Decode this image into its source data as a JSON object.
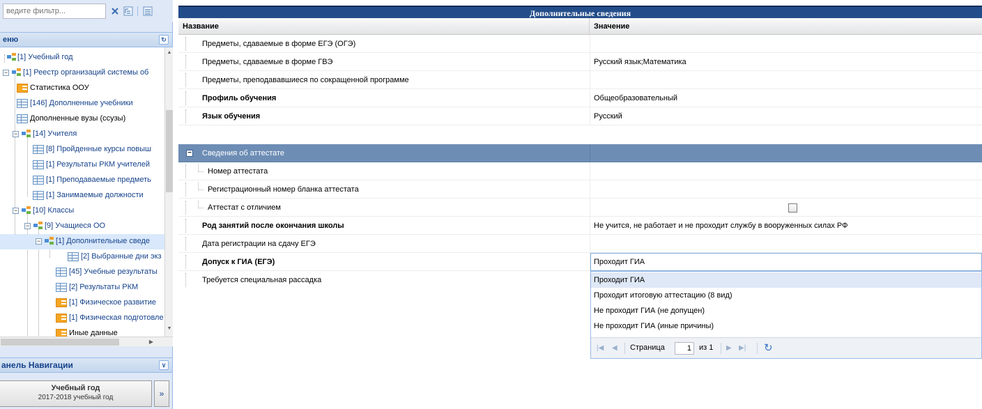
{
  "filter": {
    "placeholder": "ведите фильтр..."
  },
  "menu": {
    "title": "еню"
  },
  "tree": [
    {
      "label": "[1] Учебный год"
    },
    {
      "label": "[1] Реестр организаций системы об"
    },
    {
      "label": "Статистика ООУ"
    },
    {
      "label": "[146] Дополненные учебники"
    },
    {
      "label": "Дополненные вузы (ссузы)"
    },
    {
      "label": "[14] Учителя"
    },
    {
      "label": "[8] Пройденные курсы повыш"
    },
    {
      "label": "[1] Результаты РКМ учителей"
    },
    {
      "label": "[1] Преподаваемые предметь"
    },
    {
      "label": "[1] Занимаемые должности"
    },
    {
      "label": "[10] Классы"
    },
    {
      "label": "[9] Учащиеся ОО"
    },
    {
      "label": "[1] Дополнительные сведе"
    },
    {
      "label": "[2] Выбранные дни экз"
    },
    {
      "label": "[45] Учебные результаты"
    },
    {
      "label": "[2] Результаты РКМ"
    },
    {
      "label": "[1] Физическое развитие"
    },
    {
      "label": "[1] Физическая подготовле"
    },
    {
      "label": "Иные данные"
    }
  ],
  "nav": {
    "title": "анель Навигации",
    "card_title": "Учебный год",
    "card_value": "2017-2018 учебный год",
    "more": "»"
  },
  "grid": {
    "caption": "Дополнительные сведения",
    "col_name": "Название",
    "col_value": "Значение",
    "rows": [
      {
        "name": "Предметы, сдаваемые в форме ЕГЭ (ОГЭ)",
        "value": ""
      },
      {
        "name": "Предметы, сдаваемые в форме ГВЭ",
        "value": "Русский язык;Математика"
      },
      {
        "name": "Предметы, преподававшиеся по сокращенной программе",
        "value": ""
      },
      {
        "name": "Профиль обучения",
        "value": "Общеобразовательный"
      },
      {
        "name": "Язык обучения",
        "value": "Русский"
      },
      {
        "name": "Сведения об аттестате",
        "value": ""
      },
      {
        "name": "Номер аттестата",
        "value": ""
      },
      {
        "name": "Регистрационный номер бланка аттестата",
        "value": ""
      },
      {
        "name": "Аттестат с отличием",
        "value": ""
      },
      {
        "name": "Род занятий после окончания школы",
        "value": "Не учится, не работает и не проходит службу в вооруженных силах РФ"
      },
      {
        "name": "Дата регистрации на сдачу ЕГЭ",
        "value": ""
      },
      {
        "name": "Допуск к ГИА (ЕГЭ)",
        "value": ""
      },
      {
        "name": "Требуется специальная рассадка",
        "value": ""
      }
    ]
  },
  "combo": {
    "value": "Проходит ГИА",
    "options": [
      "Проходит ГИА",
      "Проходит итоговую аттестацию (8 вид)",
      "Не проходит ГИА (не допущен)",
      "Не проходит ГИА (иные причины)"
    ]
  },
  "pager": {
    "page_label": "Страница",
    "page": "1",
    "of": "из 1"
  }
}
